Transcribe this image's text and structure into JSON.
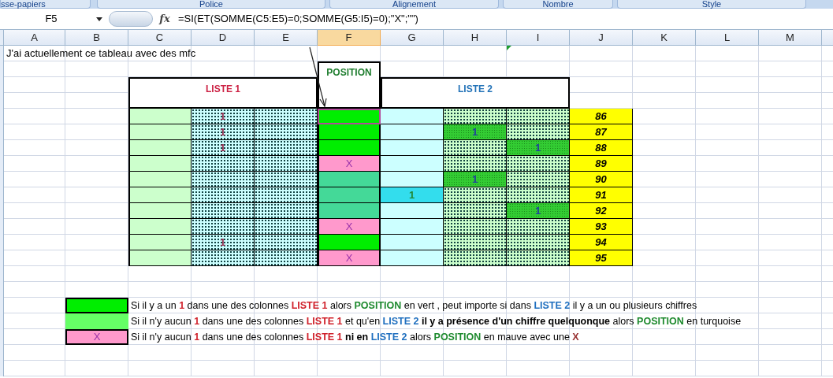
{
  "ribbon_groups": [
    "sse-papiers",
    "Police",
    "Alignement",
    "Nombre",
    "Style"
  ],
  "formula_bar": {
    "cell_reference": "F5",
    "function_label": "fx",
    "formula": "=SI(ET(SOMME(C5:E5)=0;SOMME(G5:I5)=0);\"X\";\"\")"
  },
  "columns": [
    {
      "label": "A",
      "selected": false
    },
    {
      "label": "B",
      "selected": false
    },
    {
      "label": "C",
      "selected": false
    },
    {
      "label": "D",
      "selected": false
    },
    {
      "label": "E",
      "selected": false
    },
    {
      "label": "F",
      "selected": true
    },
    {
      "label": "G",
      "selected": false
    },
    {
      "label": "H",
      "selected": false
    },
    {
      "label": "I",
      "selected": false
    },
    {
      "label": "J",
      "selected": false
    },
    {
      "label": "K",
      "selected": false
    },
    {
      "label": "L",
      "selected": false
    },
    {
      "label": "M",
      "selected": false
    }
  ],
  "intro_text": "J'ai actuellement ce tableau avec des mfc",
  "table": {
    "liste1_header": "LISTE 1",
    "position_header": "POSITION",
    "liste2_header": "LISTE 2",
    "rows": [
      {
        "d": "1",
        "position": {
          "kind": "green",
          "selected": true
        },
        "number": "86"
      },
      {
        "d": "1",
        "position": {
          "kind": "green",
          "selected": false
        },
        "h": "1",
        "number": "87"
      },
      {
        "d": "1",
        "position": {
          "kind": "green",
          "selected": false
        },
        "i": "1",
        "number": "88"
      },
      {
        "position": {
          "kind": "mauve",
          "text": "X",
          "selected": false
        },
        "number": "89"
      },
      {
        "position": {
          "kind": "turquoise",
          "selected": false
        },
        "h": "1",
        "number": "90"
      },
      {
        "position": {
          "kind": "turquoise",
          "selected": false
        },
        "g": "1",
        "number": "91"
      },
      {
        "position": {
          "kind": "turquoise",
          "selected": false
        },
        "i": "1",
        "number": "92"
      },
      {
        "position": {
          "kind": "mauve",
          "text": "X",
          "selected": false
        },
        "number": "93"
      },
      {
        "d": "1",
        "position": {
          "kind": "green",
          "selected": false
        },
        "number": "94"
      },
      {
        "position": {
          "kind": "mauve",
          "text": "X",
          "selected": false
        },
        "number": "95"
      }
    ]
  },
  "legend": [
    {
      "kind": "green",
      "segments": [
        {
          "kind": "plain",
          "text": "Si il y a un "
        },
        {
          "kind": "red",
          "text": "1"
        },
        {
          "kind": "plain",
          "text": " dans une des colonnes "
        },
        {
          "kind": "red",
          "text": "LISTE 1"
        },
        {
          "kind": "plain",
          "text": " alors "
        },
        {
          "kind": "green",
          "text": "POSITION"
        },
        {
          "kind": "plain",
          "text": " en vert , peut importe si dans "
        },
        {
          "kind": "blue",
          "text": "LISTE 2"
        },
        {
          "kind": "plain",
          "text": " il y a un ou plusieurs chiffres"
        }
      ]
    },
    {
      "kind": "lightgreen",
      "segments": [
        {
          "kind": "plain",
          "text": "Si il n'y aucun "
        },
        {
          "kind": "red",
          "text": "1"
        },
        {
          "kind": "plain",
          "text": " dans une des colonnes "
        },
        {
          "kind": "red",
          "text": "LISTE 1"
        },
        {
          "kind": "plain",
          "text": " et qu'en "
        },
        {
          "kind": "blue",
          "text": "LISTE 2"
        },
        {
          "kind": "bold",
          "text": " il y a présence d'un chiffre quelquonque"
        },
        {
          "kind": "plain",
          "text": " alors "
        },
        {
          "kind": "green",
          "text": "POSITION"
        },
        {
          "kind": "plain",
          "text": " en turquoise"
        }
      ]
    },
    {
      "kind": "pink",
      "swatch_text": "X",
      "segments": [
        {
          "kind": "plain",
          "text": "Si il n'y aucun "
        },
        {
          "kind": "red",
          "text": "1"
        },
        {
          "kind": "plain",
          "text": " dans une des colonnes "
        },
        {
          "kind": "red",
          "text": "LISTE 1"
        },
        {
          "kind": "bold",
          "text": " ni en "
        },
        {
          "kind": "blue",
          "text": "LISTE 2"
        },
        {
          "kind": "plain",
          "text": " alors "
        },
        {
          "kind": "green",
          "text": "POSITION"
        },
        {
          "kind": "plain",
          "text": " en mauve avec une "
        },
        {
          "kind": "maroon",
          "text": "X"
        }
      ]
    }
  ]
}
